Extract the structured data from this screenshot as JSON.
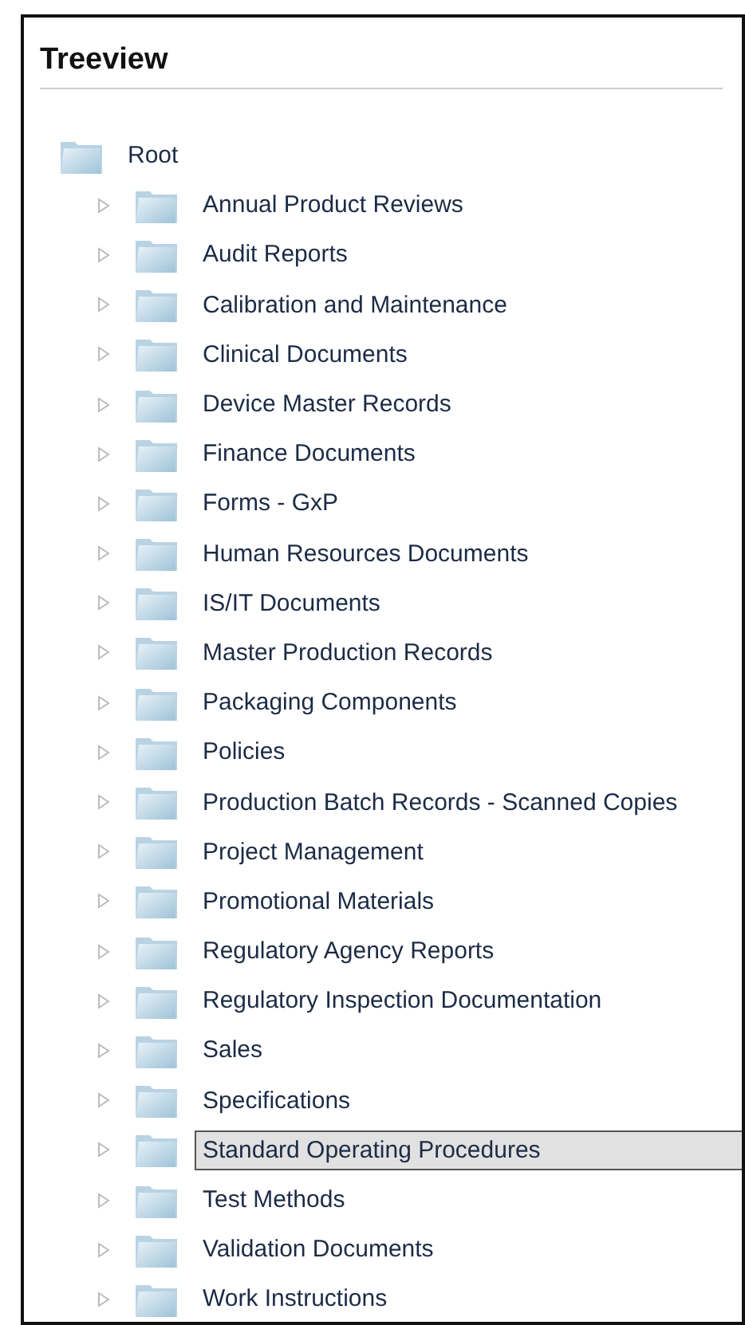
{
  "panel": {
    "title": "Treeview"
  },
  "tree": {
    "label": "Root",
    "selected": false,
    "children": [
      {
        "label": "Annual Product Reviews",
        "selected": false,
        "expanded": false
      },
      {
        "label": "Audit Reports",
        "selected": false,
        "expanded": false
      },
      {
        "label": "Calibration and Maintenance",
        "selected": false,
        "expanded": false
      },
      {
        "label": "Clinical Documents",
        "selected": false,
        "expanded": false
      },
      {
        "label": "Device Master Records",
        "selected": false,
        "expanded": false
      },
      {
        "label": "Finance Documents",
        "selected": false,
        "expanded": false
      },
      {
        "label": "Forms - GxP",
        "selected": false,
        "expanded": false
      },
      {
        "label": "Human Resources Documents",
        "selected": false,
        "expanded": false
      },
      {
        "label": "IS/IT Documents",
        "selected": false,
        "expanded": false
      },
      {
        "label": "Master Production Records",
        "selected": false,
        "expanded": false
      },
      {
        "label": "Packaging Components",
        "selected": false,
        "expanded": false
      },
      {
        "label": "Policies",
        "selected": false,
        "expanded": false
      },
      {
        "label": "Production Batch Records - Scanned Copies",
        "selected": false,
        "expanded": false
      },
      {
        "label": "Project Management",
        "selected": false,
        "expanded": false
      },
      {
        "label": "Promotional Materials",
        "selected": false,
        "expanded": false
      },
      {
        "label": "Regulatory Agency Reports",
        "selected": false,
        "expanded": false
      },
      {
        "label": "Regulatory Inspection Documentation",
        "selected": false,
        "expanded": false
      },
      {
        "label": "Sales",
        "selected": false,
        "expanded": false
      },
      {
        "label": "Specifications",
        "selected": false,
        "expanded": false
      },
      {
        "label": "Standard Operating Procedures",
        "selected": true,
        "expanded": false
      },
      {
        "label": "Test Methods",
        "selected": false,
        "expanded": false
      },
      {
        "label": "Validation Documents",
        "selected": false,
        "expanded": false
      },
      {
        "label": "Work Instructions",
        "selected": false,
        "expanded": false
      }
    ]
  }
}
